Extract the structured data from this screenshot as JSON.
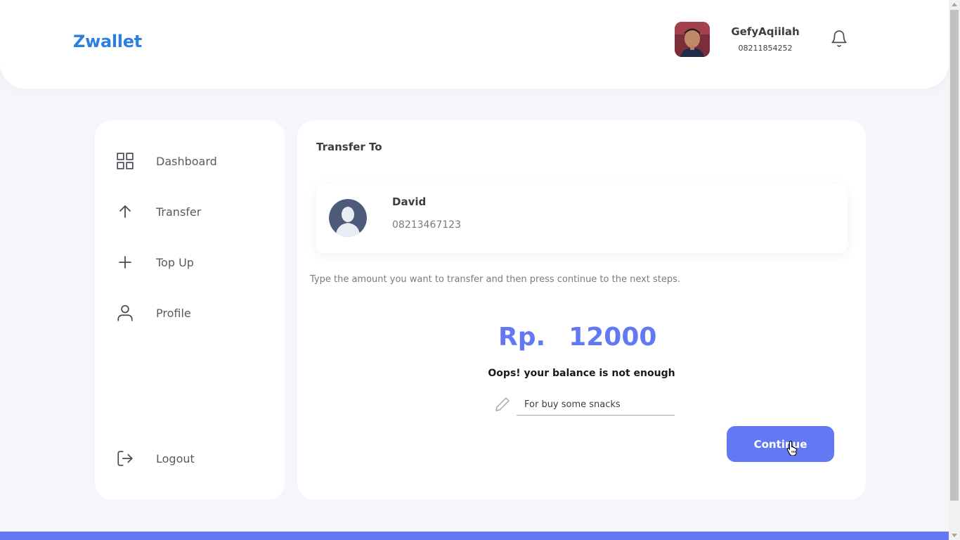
{
  "app": {
    "brand": "Zwallet",
    "accent_color": "#6379f4",
    "brand_color": "#2a7fe0"
  },
  "header": {
    "user": {
      "name": "GefyAqiilah",
      "phone": "08211854252",
      "avatar_icon": "user-photo"
    },
    "notification_icon": "bell-icon"
  },
  "sidebar": {
    "items": [
      {
        "label": "Dashboard",
        "icon": "grid-icon"
      },
      {
        "label": "Transfer",
        "icon": "arrow-up-icon"
      },
      {
        "label": "Top Up",
        "icon": "plus-icon"
      },
      {
        "label": "Profile",
        "icon": "user-icon"
      }
    ],
    "logout": {
      "label": "Logout",
      "icon": "logout-icon"
    }
  },
  "transfer": {
    "title": "Transfer To",
    "receiver": {
      "name": "David",
      "phone": "08213467123",
      "avatar_icon": "default-avatar-icon"
    },
    "instruction": "Type the amount you want to transfer and then press continue to the next steps.",
    "amount": {
      "currency": "Rp.",
      "value": "12000"
    },
    "warning": "Oops! your balance is not enough",
    "notes": {
      "icon": "pencil-icon",
      "value": "For buy some snacks"
    },
    "continue_label": "Continue"
  }
}
